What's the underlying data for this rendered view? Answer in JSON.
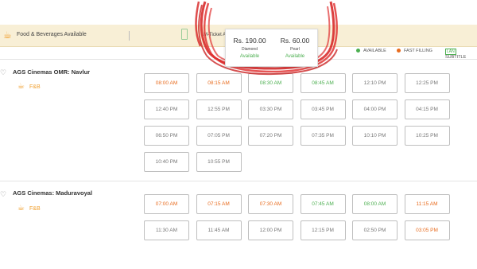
{
  "info_bar": {
    "food_label": "Food & Beverages Available",
    "mticket_label": "M-Ticket Available"
  },
  "legend": {
    "available": "AVAILABLE",
    "fast_filling": "FAST FILLING",
    "lan_badge": "LAN",
    "subtitle": "SUBTITLE",
    "available_color": "#4caf50",
    "fast_filling_color": "#e86c1f"
  },
  "tooltip": {
    "tiers": [
      {
        "price": "Rs. 190.00",
        "class": "Diamond",
        "status": "Available"
      },
      {
        "price": "Rs. 60.00",
        "class": "Pearl",
        "status": "Available"
      }
    ]
  },
  "cinemas": [
    {
      "name": "AGS Cinemas OMR: Navlur",
      "fnb": "F&B",
      "showtimes": [
        {
          "time": "08:00 AM",
          "status": "fast"
        },
        {
          "time": "08:15 AM",
          "status": "fast"
        },
        {
          "time": "08:30 AM",
          "status": "available"
        },
        {
          "time": "08:45 AM",
          "status": "available"
        },
        {
          "time": "12:10 PM",
          "status": "normal"
        },
        {
          "time": "12:25 PM",
          "status": "normal"
        },
        {
          "time": "12:40 PM",
          "status": "normal"
        },
        {
          "time": "12:55 PM",
          "status": "normal"
        },
        {
          "time": "03:30 PM",
          "status": "normal"
        },
        {
          "time": "03:45 PM",
          "status": "normal"
        },
        {
          "time": "04:00 PM",
          "status": "normal"
        },
        {
          "time": "04:15 PM",
          "status": "normal"
        },
        {
          "time": "06:50 PM",
          "status": "normal"
        },
        {
          "time": "07:05 PM",
          "status": "normal"
        },
        {
          "time": "07:20 PM",
          "status": "normal"
        },
        {
          "time": "07:35 PM",
          "status": "normal"
        },
        {
          "time": "10:10 PM",
          "status": "normal"
        },
        {
          "time": "10:25 PM",
          "status": "normal"
        },
        {
          "time": "10:40 PM",
          "status": "normal"
        },
        {
          "time": "10:55 PM",
          "status": "normal"
        }
      ]
    },
    {
      "name": "AGS Cinemas: Maduravoyal",
      "fnb": "F&B",
      "showtimes": [
        {
          "time": "07:00 AM",
          "status": "fast"
        },
        {
          "time": "07:15 AM",
          "status": "fast"
        },
        {
          "time": "07:30 AM",
          "status": "fast"
        },
        {
          "time": "07:45 AM",
          "status": "available"
        },
        {
          "time": "08:00 AM",
          "status": "available"
        },
        {
          "time": "11:15 AM",
          "status": "fast"
        },
        {
          "time": "11:30 AM",
          "status": "normal"
        },
        {
          "time": "11:45 AM",
          "status": "normal"
        },
        {
          "time": "12:00 PM",
          "status": "normal"
        },
        {
          "time": "12:15 PM",
          "status": "normal"
        },
        {
          "time": "02:50 PM",
          "status": "normal"
        },
        {
          "time": "03:05 PM",
          "status": "fast"
        }
      ]
    }
  ]
}
